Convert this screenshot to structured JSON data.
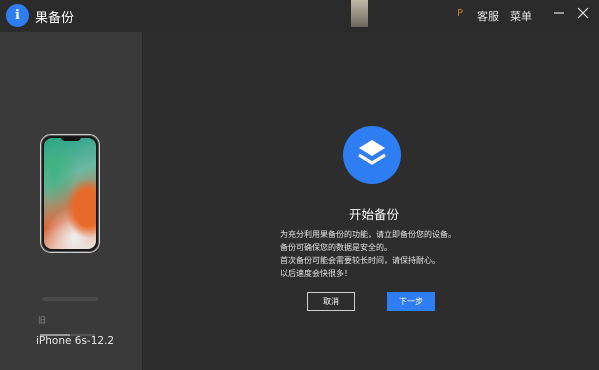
{
  "titlebar": {
    "app_title": "果备份",
    "logo_glyph": "i",
    "marker": "P",
    "menu": [
      {
        "label": "客服"
      },
      {
        "label": "菜单"
      }
    ]
  },
  "sidebar": {
    "small_text": "旧",
    "device_name": "iPhone 6s-12.2",
    "progress": 0.55
  },
  "main": {
    "title": "开始备份",
    "description": [
      "为充分利用果备份的功能，请立即备份您的设备。",
      "备份可确保您的数据是安全的。",
      "首次备份可能会需要较长时间，请保持耐心。",
      "以后速度会快很多！"
    ],
    "cancel_label": "取消",
    "next_label": "下一步"
  },
  "colors": {
    "accent": "#2f7df2",
    "background": "#2d2d2d",
    "sidebar": "#3a3a3a"
  }
}
